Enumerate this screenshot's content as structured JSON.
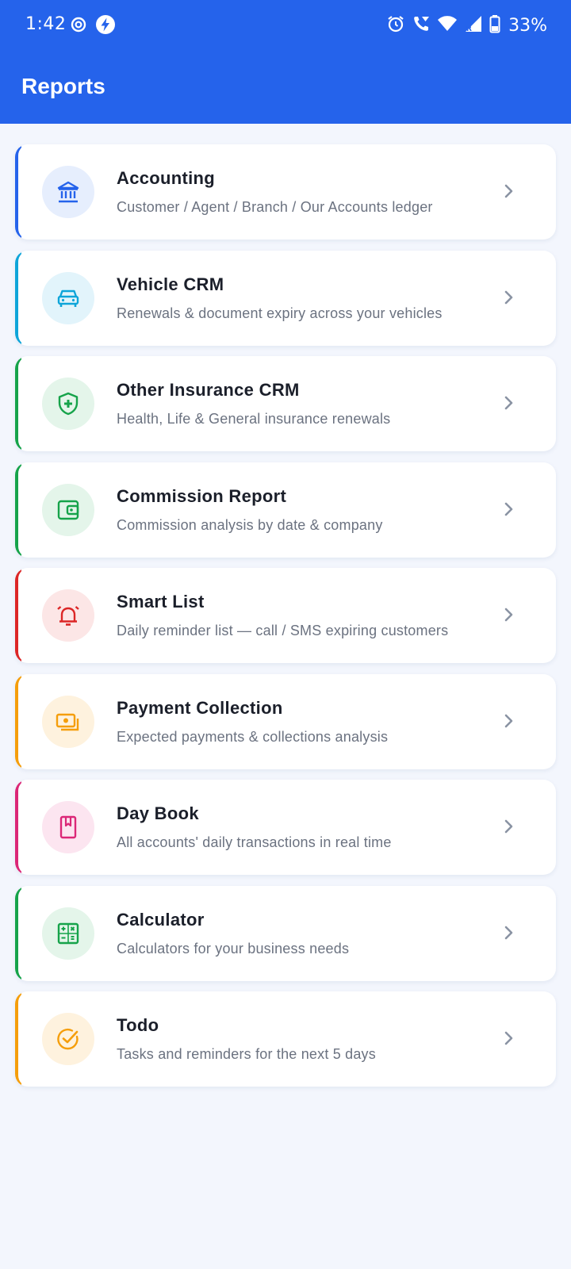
{
  "status_bar": {
    "time": "1:42",
    "battery": "33%",
    "icons": [
      "settings-circle-icon",
      "bolt-icon",
      "alarm-icon",
      "wifi-call-icon",
      "wifi-icon",
      "signal-icon",
      "battery-icon"
    ]
  },
  "app_bar": {
    "title": "Reports"
  },
  "theme": {
    "primary": "#2563EB",
    "background": "#F3F6FD"
  },
  "reports": [
    {
      "title": "Accounting",
      "subtitle": "Customer / Agent / Branch / Our Accounts ledger",
      "icon": "bank-icon",
      "accent": "#2563EB",
      "icon_bg": "#E6EEFD"
    },
    {
      "title": "Vehicle CRM",
      "subtitle": "Renewals & document expiry across your vehicles",
      "icon": "car-icon",
      "accent": "#0EA5D9",
      "icon_bg": "#E2F4FB"
    },
    {
      "title": "Other Insurance CRM",
      "subtitle": "Health, Life & General insurance renewals",
      "icon": "shield-plus-icon",
      "accent": "#16A34A",
      "icon_bg": "#E4F5EA"
    },
    {
      "title": "Commission Report",
      "subtitle": "Commission analysis by date & company",
      "icon": "wallet-icon",
      "accent": "#16A34A",
      "icon_bg": "#E4F5EA"
    },
    {
      "title": "Smart List",
      "subtitle": "Daily reminder list — call / SMS expiring customers",
      "icon": "alarm-bell-icon",
      "accent": "#DC2626",
      "icon_bg": "#FCE6E6"
    },
    {
      "title": "Payment Collection",
      "subtitle": "Expected payments & collections analysis",
      "icon": "cash-icon",
      "accent": "#F59E0B",
      "icon_bg": "#FEF2DE"
    },
    {
      "title": "Day Book",
      "subtitle": "All accounts' daily transactions in real time",
      "icon": "bookmark-book-icon",
      "accent": "#DB2777",
      "icon_bg": "#FCE5F0"
    },
    {
      "title": "Calculator",
      "subtitle": "Calculators for your business needs",
      "icon": "calculator-icon",
      "accent": "#16A34A",
      "icon_bg": "#E4F5EA"
    },
    {
      "title": "Todo",
      "subtitle": "Tasks and reminders for the next 5 days",
      "icon": "check-circle-icon",
      "accent": "#F59E0B",
      "icon_bg": "#FEF2DE"
    }
  ]
}
